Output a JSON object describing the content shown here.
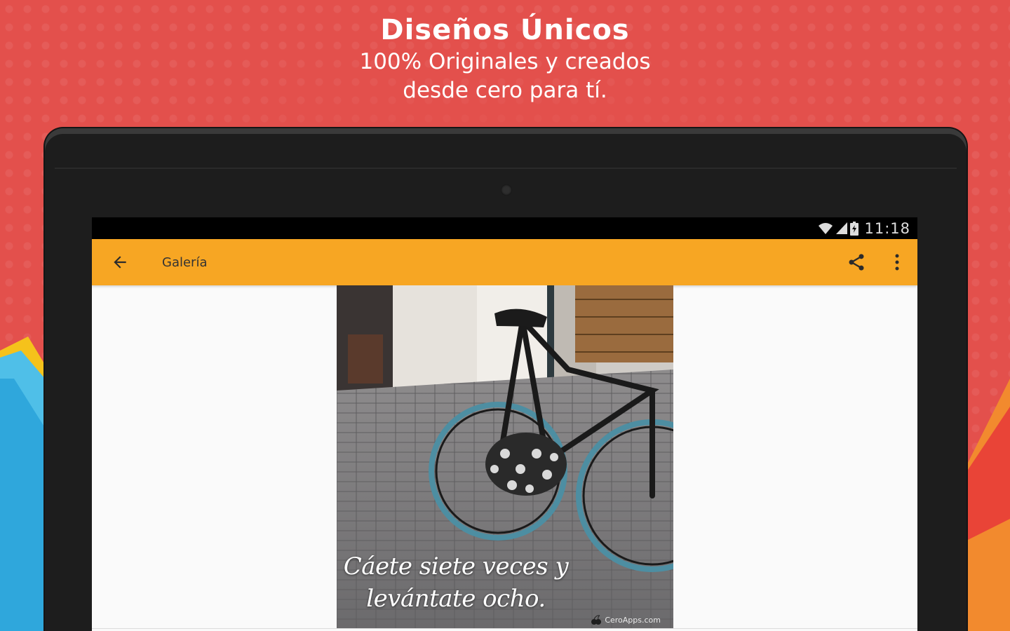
{
  "promo": {
    "title": "Diseños Únicos",
    "subtitle": "100% Originales y creados desde cero para tí."
  },
  "status_bar": {
    "time": "11:18",
    "icons": [
      "wifi-icon",
      "signal-icon",
      "battery-icon"
    ]
  },
  "app_bar": {
    "title": "Galería",
    "back_icon": "arrow-left-icon",
    "share_icon": "share-icon",
    "menu_icon": "more-vert-icon"
  },
  "image": {
    "quote": "Cáete siete veces y levántate ocho.",
    "watermark": "CeroApps.com"
  },
  "colors": {
    "background": "#e3504c",
    "app_bar": "#f7a623",
    "status_bar": "#000000",
    "device": "#1d1d1d"
  }
}
